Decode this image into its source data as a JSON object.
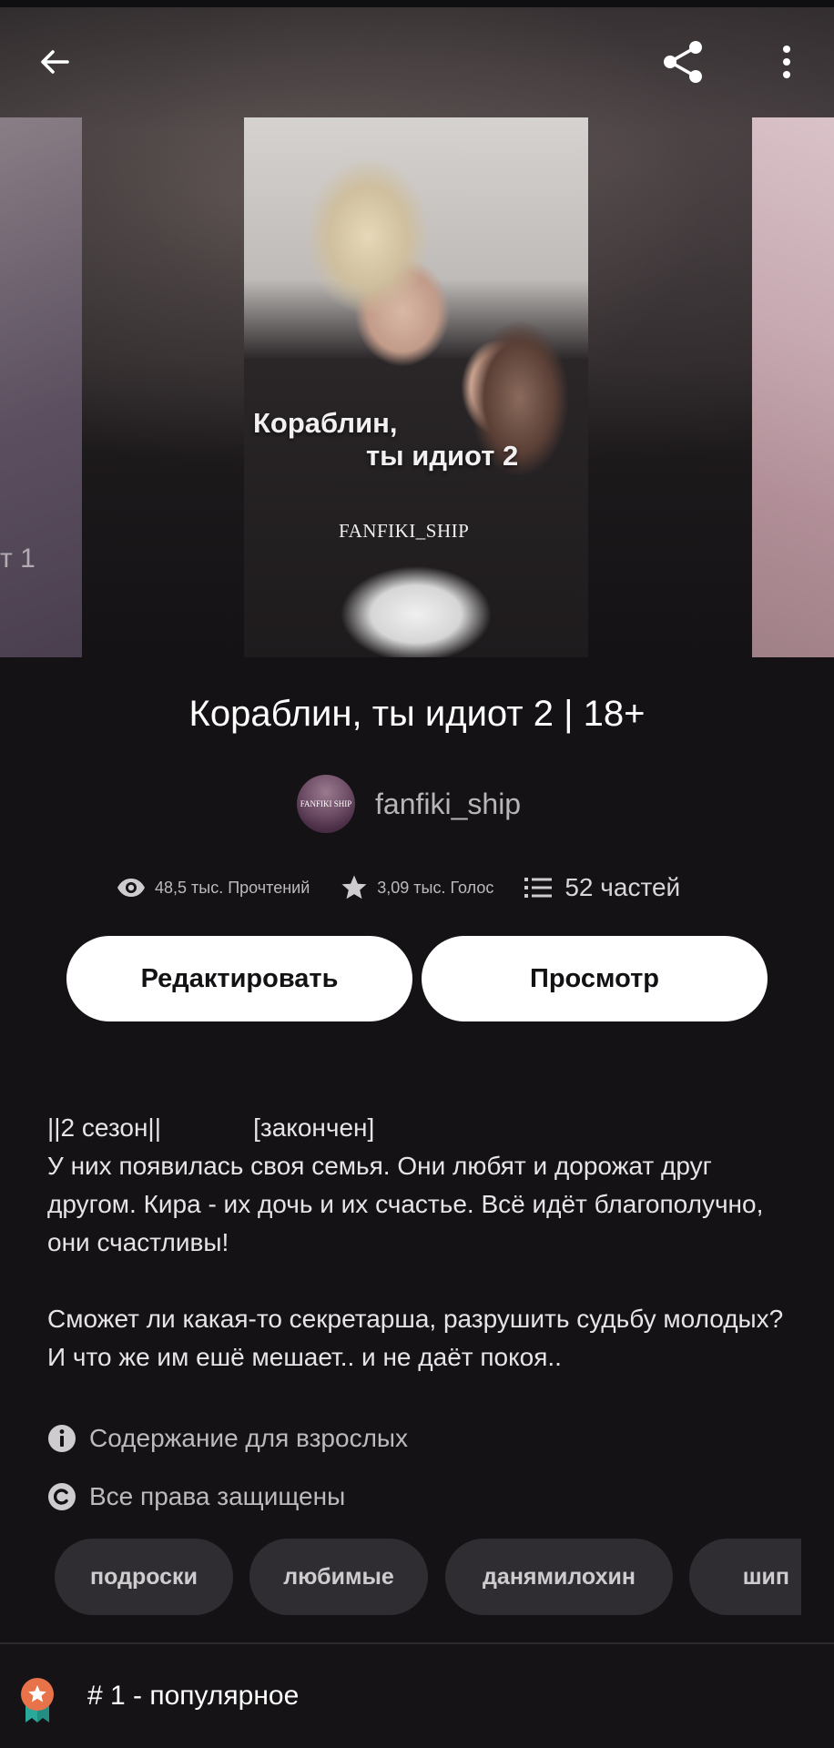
{
  "cover": {
    "title_line1": "Кораблин,",
    "title_line2": "ты идиот 2",
    "brand": "FANFIKI_SHIP",
    "left_partial_text": "т 1"
  },
  "story": {
    "title": "Кораблин, ты идиот 2  | 18+"
  },
  "author": {
    "name": "fanfiki_ship",
    "avatar_text": "FANFIKI SHIP"
  },
  "stats": {
    "reads": "48,5 тыс. Прочтений",
    "votes": "3,09 тыс. Голос",
    "parts": "52 частей"
  },
  "actions": {
    "edit_label": "Редактировать",
    "view_label": "Просмотр"
  },
  "description": "||2 сезон||             [закончен]\nУ них появилась своя семья. Они любят и дорожат друг другом. Кира - их дочь и их счастье. Всё идёт благополучно, они счастливы!\n\nСможет ли какая-то секретарша, разрушить судьбу молодых? И что же им ешё мешает.. и не даёт покоя..",
  "meta": {
    "mature": "Содержание для взрослых",
    "copyright": "Все права защищены"
  },
  "tags": [
    "подроски",
    "любимые",
    "данямилохин",
    "шип"
  ],
  "ranking": {
    "label": "# 1 - популярное"
  },
  "colors": {
    "background": "#141215",
    "button_bg": "#ffffff",
    "tag_bg": "#2f2d31",
    "badge_orange": "#e8734a",
    "badge_teal": "#2aa89a"
  },
  "icons": [
    "back-arrow-icon",
    "share-icon",
    "more-vertical-icon",
    "eye-icon",
    "star-icon",
    "list-icon",
    "info-icon",
    "copyright-icon",
    "ranking-badge-icon"
  ]
}
